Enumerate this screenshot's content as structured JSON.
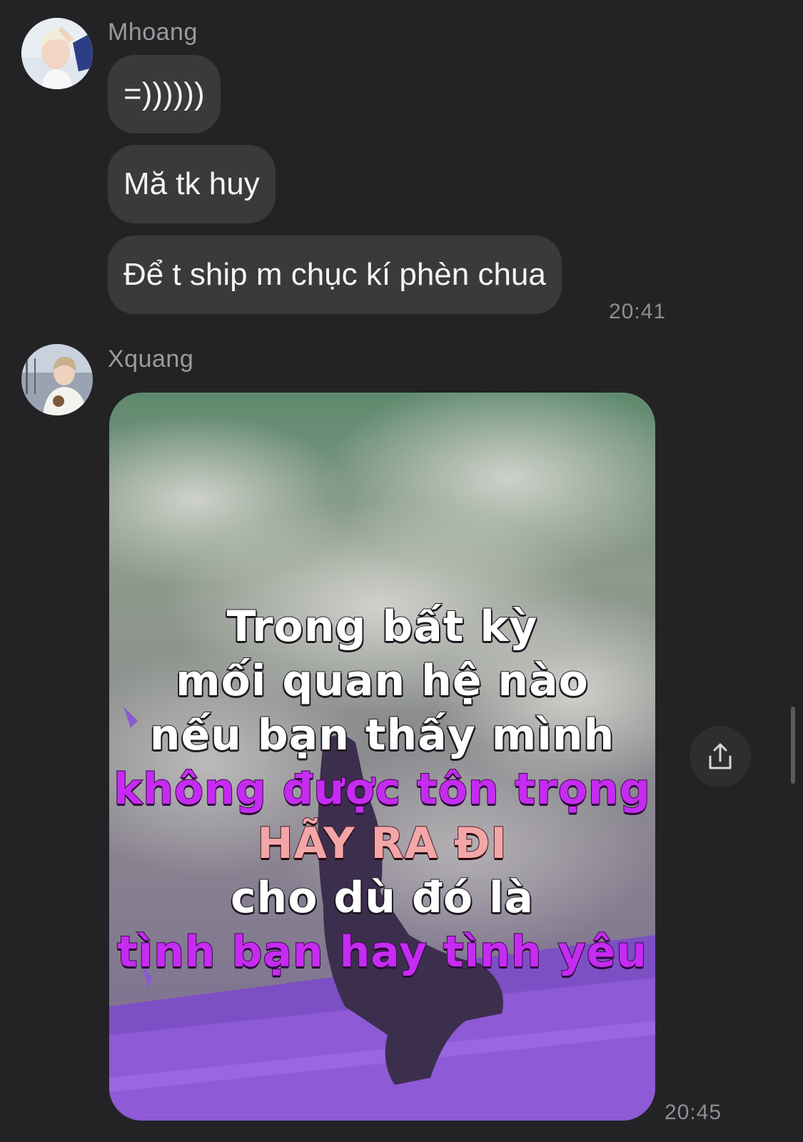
{
  "messages": [
    {
      "sender": "Mhoang",
      "avatar_icon": "user-avatar-blond-hair",
      "bubbles": [
        "=))))))",
        "Mă tk huy",
        "Để t ship m chục kí phèn chua"
      ],
      "time": "20:41"
    },
    {
      "sender": "Xquang",
      "avatar_icon": "user-avatar-outdoor-photo",
      "image_caption_lines": [
        "Trong bất kỳ",
        "mối quan hệ nào",
        "nếu bạn thấy mình",
        "không được tôn trọng",
        "HÃY RA ĐI",
        "cho dù đó là",
        "tình bạn hay tình yêu"
      ],
      "time": "20:45"
    }
  ],
  "share_icon": "share-upload-icon",
  "colors": {
    "background": "#232325",
    "bubble": "#3a3a3c",
    "caption_purple": "#c62bf1",
    "caption_pink": "#f3a6a8"
  }
}
